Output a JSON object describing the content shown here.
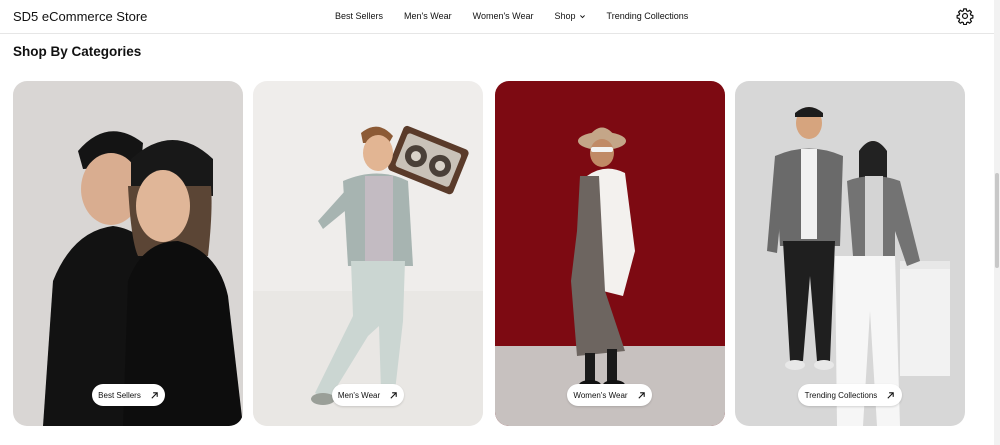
{
  "header": {
    "brand": "SD5 eCommerce Store",
    "nav": [
      {
        "label": "Best Sellers"
      },
      {
        "label": "Men's Wear"
      },
      {
        "label": "Women's Wear"
      },
      {
        "label": "Shop",
        "has_dropdown": true
      },
      {
        "label": "Trending Collections"
      }
    ],
    "settings_icon": "gear-icon"
  },
  "main": {
    "section_title": "Shop By Categories",
    "categories": [
      {
        "label": "Best Sellers",
        "icon": "arrow-up-right-icon",
        "bg": "#d9d6d4"
      },
      {
        "label": "Men's Wear",
        "icon": "arrow-up-right-icon",
        "bg": "#efedeb"
      },
      {
        "label": "Women's Wear",
        "icon": "arrow-up-right-icon",
        "bg": "#7d0a12"
      },
      {
        "label": "Trending Collections",
        "icon": "arrow-up-right-icon",
        "bg": "#d7d7d7"
      }
    ]
  }
}
